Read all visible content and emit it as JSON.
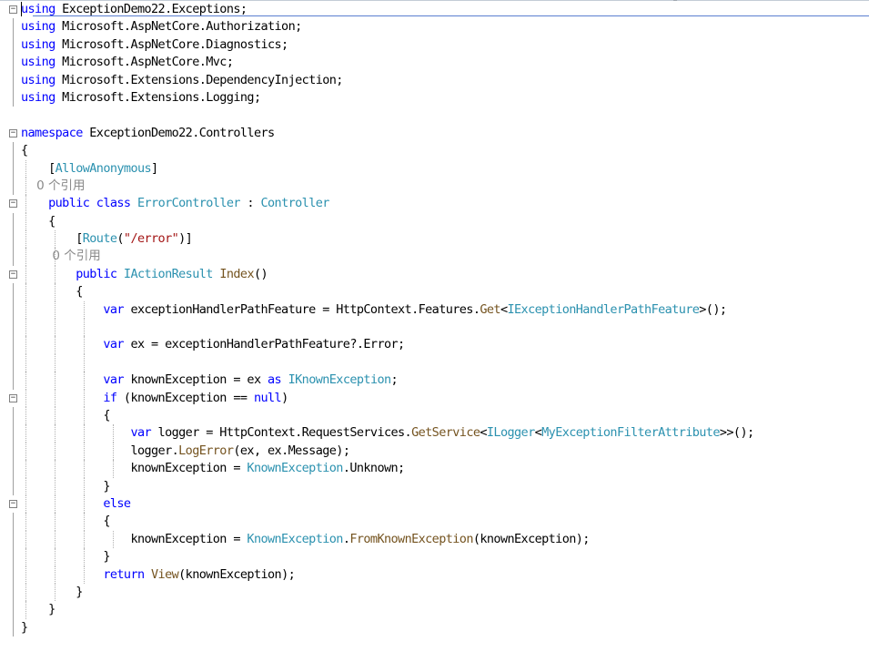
{
  "editor": {
    "lines": [
      {
        "fold": "minus",
        "guides": [],
        "segments": [
          {
            "t": "using",
            "c": "k"
          },
          {
            "t": " ExceptionDemo22.Exceptions;",
            "c": "p"
          }
        ]
      },
      {
        "fold": "bar",
        "guides": [],
        "segments": [
          {
            "t": "using",
            "c": "k"
          },
          {
            "t": " Microsoft.AspNetCore.Authorization;",
            "c": "p"
          }
        ]
      },
      {
        "fold": "bar",
        "guides": [],
        "segments": [
          {
            "t": "using",
            "c": "k"
          },
          {
            "t": " Microsoft.AspNetCore.Diagnostics;",
            "c": "p"
          }
        ]
      },
      {
        "fold": "bar",
        "guides": [],
        "segments": [
          {
            "t": "using",
            "c": "k"
          },
          {
            "t": " Microsoft.AspNetCore.Mvc;",
            "c": "p"
          }
        ]
      },
      {
        "fold": "bar",
        "guides": [],
        "segments": [
          {
            "t": "using",
            "c": "k"
          },
          {
            "t": " Microsoft.Extensions.DependencyInjection;",
            "c": "p"
          }
        ]
      },
      {
        "fold": "bar",
        "guides": [],
        "segments": [
          {
            "t": "using",
            "c": "k"
          },
          {
            "t": " Microsoft.Extensions.Logging;",
            "c": "p"
          }
        ]
      },
      {
        "fold": "",
        "guides": [],
        "segments": []
      },
      {
        "fold": "minus",
        "guides": [],
        "segments": [
          {
            "t": "namespace",
            "c": "k"
          },
          {
            "t": " ExceptionDemo22.Controllers",
            "c": "p"
          }
        ]
      },
      {
        "fold": "bar",
        "guides": [],
        "segments": [
          {
            "t": "{",
            "c": "p"
          }
        ]
      },
      {
        "fold": "bar",
        "guides": [
          28
        ],
        "segments": [
          {
            "t": "    [",
            "c": "p"
          },
          {
            "t": "AllowAnonymous",
            "c": "t"
          },
          {
            "t": "]",
            "c": "p"
          }
        ]
      },
      {
        "fold": "bar",
        "guides": [
          28
        ],
        "segments": [
          {
            "t": "    0 个引用",
            "c": "lens"
          }
        ]
      },
      {
        "fold": "minus",
        "guides": [
          28
        ],
        "segments": [
          {
            "t": "    public class ",
            "c": "k"
          },
          {
            "t": "ErrorController",
            "c": "t"
          },
          {
            "t": " : ",
            "c": "p"
          },
          {
            "t": "Controller",
            "c": "t"
          }
        ]
      },
      {
        "fold": "bar",
        "guides": [
          28
        ],
        "segments": [
          {
            "t": "    {",
            "c": "p"
          }
        ]
      },
      {
        "fold": "bar",
        "guides": [
          28,
          60
        ],
        "segments": [
          {
            "t": "        [",
            "c": "p"
          },
          {
            "t": "Route",
            "c": "t"
          },
          {
            "t": "(",
            "c": "p"
          },
          {
            "t": "\"/error\"",
            "c": "s"
          },
          {
            "t": ")]",
            "c": "p"
          }
        ]
      },
      {
        "fold": "bar",
        "guides": [
          28,
          60
        ],
        "segments": [
          {
            "t": "        0 个引用",
            "c": "lens"
          }
        ]
      },
      {
        "fold": "minus",
        "guides": [
          28,
          60
        ],
        "segments": [
          {
            "t": "        public ",
            "c": "k"
          },
          {
            "t": "IActionResult",
            "c": "t"
          },
          {
            "t": " ",
            "c": "p"
          },
          {
            "t": "Index",
            "c": "m"
          },
          {
            "t": "()",
            "c": "p"
          }
        ]
      },
      {
        "fold": "bar",
        "guides": [
          28,
          60
        ],
        "segments": [
          {
            "t": "        {",
            "c": "p"
          }
        ]
      },
      {
        "fold": "bar",
        "guides": [
          28,
          60,
          92
        ],
        "segments": [
          {
            "t": "            var",
            "c": "k"
          },
          {
            "t": " exceptionHandlerPathFeature = HttpContext.Features.",
            "c": "p"
          },
          {
            "t": "Get",
            "c": "m"
          },
          {
            "t": "<",
            "c": "p"
          },
          {
            "t": "IExceptionHandlerPathFeature",
            "c": "t"
          },
          {
            "t": ">();",
            "c": "p"
          }
        ]
      },
      {
        "fold": "bar",
        "guides": [
          28,
          60,
          92
        ],
        "segments": []
      },
      {
        "fold": "bar",
        "guides": [
          28,
          60,
          92
        ],
        "segments": [
          {
            "t": "            var",
            "c": "k"
          },
          {
            "t": " ex = exceptionHandlerPathFeature?.Error;",
            "c": "p"
          }
        ]
      },
      {
        "fold": "bar",
        "guides": [
          28,
          60,
          92
        ],
        "segments": []
      },
      {
        "fold": "bar",
        "guides": [
          28,
          60,
          92
        ],
        "segments": [
          {
            "t": "            var",
            "c": "k"
          },
          {
            "t": " knownException = ex ",
            "c": "p"
          },
          {
            "t": "as",
            "c": "k"
          },
          {
            "t": " ",
            "c": "p"
          },
          {
            "t": "IKnownException",
            "c": "t"
          },
          {
            "t": ";",
            "c": "p"
          }
        ]
      },
      {
        "fold": "minus",
        "guides": [
          28,
          60,
          92
        ],
        "segments": [
          {
            "t": "            if",
            "c": "k"
          },
          {
            "t": " (knownException == ",
            "c": "p"
          },
          {
            "t": "null",
            "c": "k"
          },
          {
            "t": ")",
            "c": "p"
          }
        ]
      },
      {
        "fold": "bar",
        "guides": [
          28,
          60,
          92
        ],
        "segments": [
          {
            "t": "            {",
            "c": "p"
          }
        ]
      },
      {
        "fold": "bar",
        "guides": [
          28,
          60,
          92,
          124
        ],
        "segments": [
          {
            "t": "                var",
            "c": "k"
          },
          {
            "t": " logger = HttpContext.RequestServices.",
            "c": "p"
          },
          {
            "t": "GetService",
            "c": "m"
          },
          {
            "t": "<",
            "c": "p"
          },
          {
            "t": "ILogger",
            "c": "t"
          },
          {
            "t": "<",
            "c": "p"
          },
          {
            "t": "MyExceptionFilterAttribute",
            "c": "t"
          },
          {
            "t": ">>();",
            "c": "p"
          }
        ]
      },
      {
        "fold": "bar",
        "guides": [
          28,
          60,
          92,
          124
        ],
        "segments": [
          {
            "t": "                logger.",
            "c": "p"
          },
          {
            "t": "LogError",
            "c": "m"
          },
          {
            "t": "(ex, ex.Message);",
            "c": "p"
          }
        ]
      },
      {
        "fold": "bar",
        "guides": [
          28,
          60,
          92,
          124
        ],
        "segments": [
          {
            "t": "                knownException = ",
            "c": "p"
          },
          {
            "t": "KnownException",
            "c": "t"
          },
          {
            "t": ".Unknown;",
            "c": "p"
          }
        ]
      },
      {
        "fold": "bar",
        "guides": [
          28,
          60,
          92
        ],
        "segments": [
          {
            "t": "            }",
            "c": "p"
          }
        ]
      },
      {
        "fold": "minus",
        "guides": [
          28,
          60,
          92
        ],
        "segments": [
          {
            "t": "            else",
            "c": "k"
          }
        ]
      },
      {
        "fold": "bar",
        "guides": [
          28,
          60,
          92
        ],
        "segments": [
          {
            "t": "            {",
            "c": "p"
          }
        ]
      },
      {
        "fold": "bar",
        "guides": [
          28,
          60,
          92,
          124
        ],
        "segments": [
          {
            "t": "                knownException = ",
            "c": "p"
          },
          {
            "t": "KnownException",
            "c": "t"
          },
          {
            "t": ".",
            "c": "p"
          },
          {
            "t": "FromKnownException",
            "c": "m"
          },
          {
            "t": "(knownException);",
            "c": "p"
          }
        ]
      },
      {
        "fold": "bar",
        "guides": [
          28,
          60,
          92
        ],
        "segments": [
          {
            "t": "            }",
            "c": "p"
          }
        ]
      },
      {
        "fold": "bar",
        "guides": [
          28,
          60,
          92
        ],
        "segments": [
          {
            "t": "            return",
            "c": "k"
          },
          {
            "t": " ",
            "c": "p"
          },
          {
            "t": "View",
            "c": "m"
          },
          {
            "t": "(knownException);",
            "c": "p"
          }
        ]
      },
      {
        "fold": "bar",
        "guides": [
          28,
          60
        ],
        "segments": [
          {
            "t": "        }",
            "c": "p"
          }
        ]
      },
      {
        "fold": "bar",
        "guides": [
          28
        ],
        "segments": [
          {
            "t": "    }",
            "c": "p"
          }
        ]
      },
      {
        "fold": "bar",
        "guides": [],
        "segments": [
          {
            "t": "}",
            "c": "p"
          }
        ]
      }
    ]
  }
}
